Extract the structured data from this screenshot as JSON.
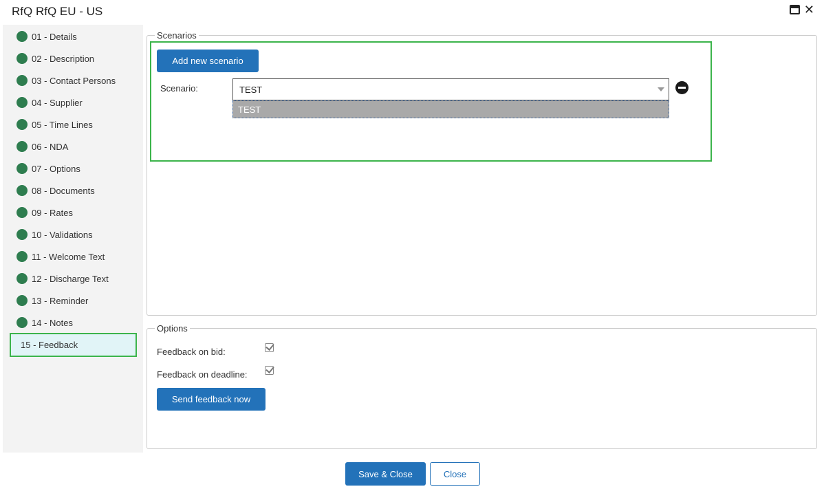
{
  "window": {
    "title": "RfQ RfQ EU - US",
    "icons": [
      "maximize-icon",
      "close-icon"
    ]
  },
  "sidebar": {
    "items": [
      {
        "label": "01 - Details",
        "status": "complete"
      },
      {
        "label": "02 - Description",
        "status": "complete"
      },
      {
        "label": "03 - Contact Persons",
        "status": "complete"
      },
      {
        "label": "04 - Supplier",
        "status": "complete"
      },
      {
        "label": "05 - Time Lines",
        "status": "complete"
      },
      {
        "label": "06 - NDA",
        "status": "complete"
      },
      {
        "label": "07 - Options",
        "status": "complete"
      },
      {
        "label": "08 - Documents",
        "status": "complete"
      },
      {
        "label": "09 - Rates",
        "status": "complete"
      },
      {
        "label": "10 - Validations",
        "status": "complete"
      },
      {
        "label": "11 - Welcome Text",
        "status": "complete"
      },
      {
        "label": "12 - Discharge Text",
        "status": "complete"
      },
      {
        "label": "13 - Reminder",
        "status": "complete"
      },
      {
        "label": "14 - Notes",
        "status": "complete"
      },
      {
        "label": "15 - Feedback",
        "status": "active"
      }
    ],
    "status_color": "#2e7d4f",
    "active_border_color": "#3cb44b"
  },
  "scenarios": {
    "legend": "Scenarios",
    "add_button": "Add new scenario",
    "scenario_label": "Scenario:",
    "scenario_value": "TEST",
    "dropdown_options": [
      "TEST"
    ]
  },
  "options": {
    "legend": "Options",
    "feedback_on_bid_label": "Feedback on bid:",
    "feedback_on_bid_checked": true,
    "feedback_on_deadline_label": "Feedback on deadline:",
    "feedback_on_deadline_checked": true,
    "send_button": "Send feedback now"
  },
  "footer": {
    "save_close": "Save & Close",
    "close": "Close"
  },
  "colors": {
    "primary": "#2372b9",
    "highlight": "#3cb44b"
  }
}
